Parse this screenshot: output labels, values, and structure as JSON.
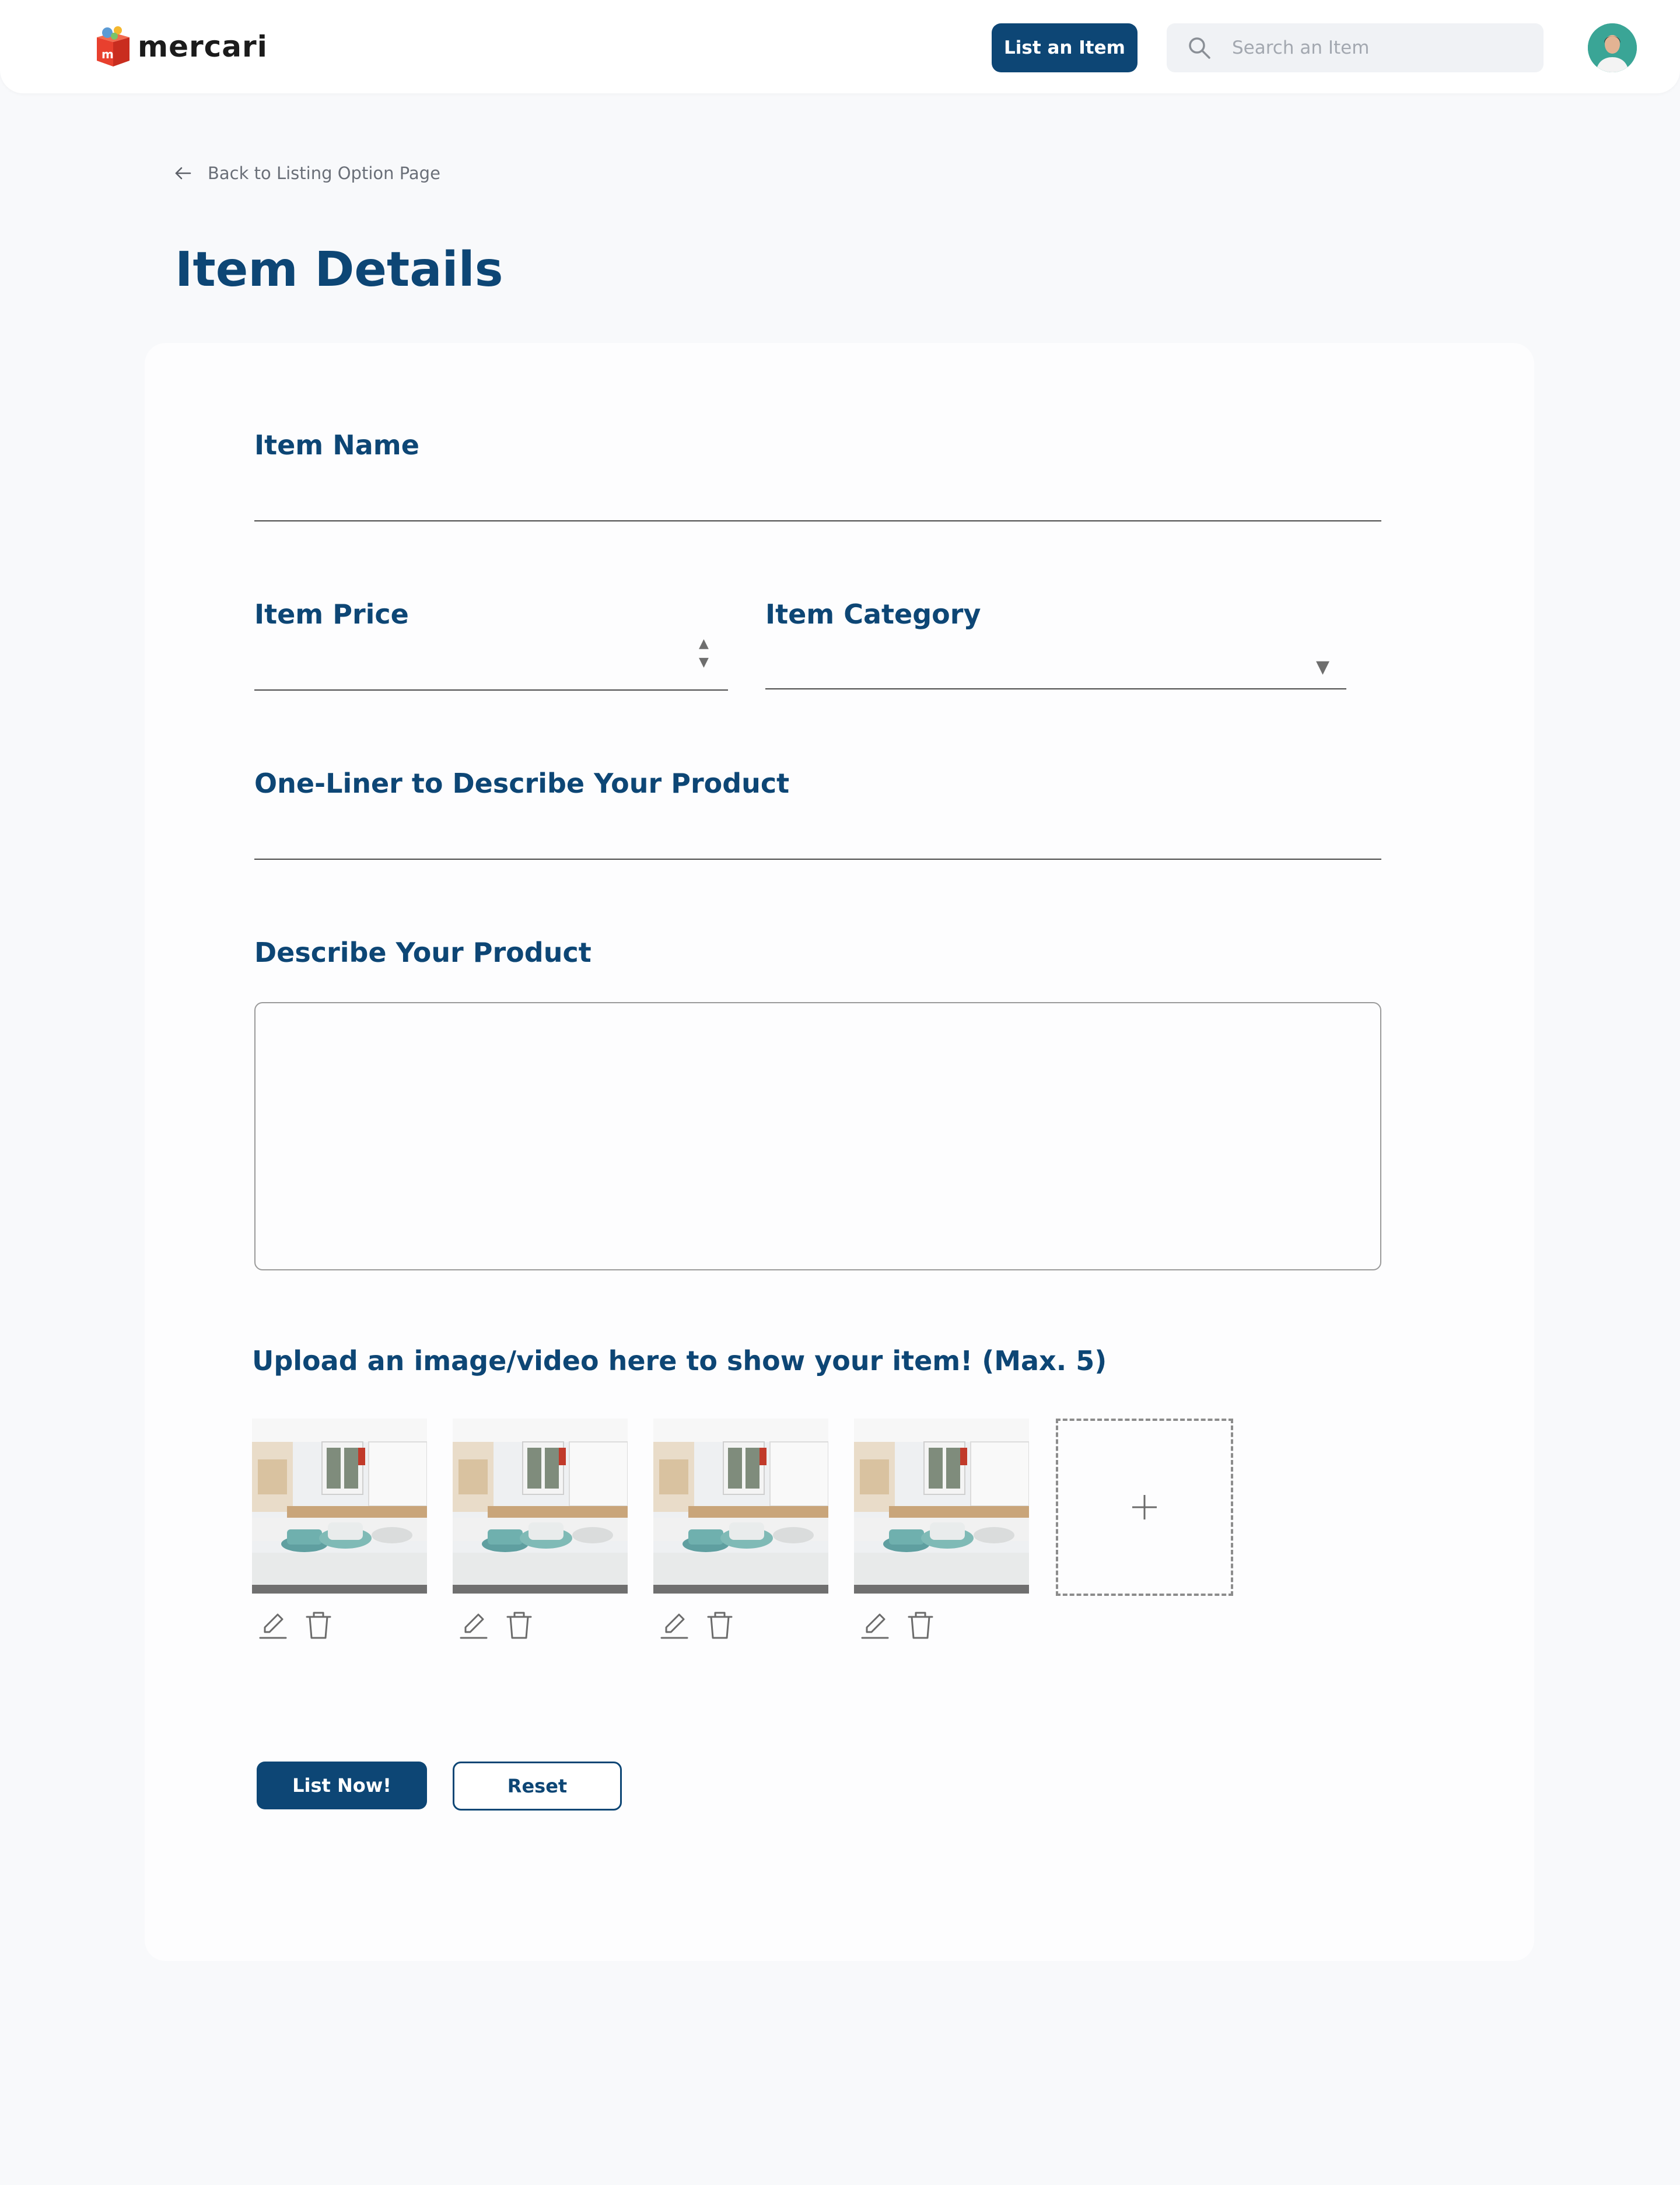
{
  "header": {
    "logo_text": "mercari",
    "list_button": "List an Item",
    "search_placeholder": "Search an Item"
  },
  "nav": {
    "back_label": "Back to Listing Option Page"
  },
  "page": {
    "title": "Item Details"
  },
  "form": {
    "item_name_label": "Item Name",
    "item_price_label": "Item Price",
    "item_category_label": "Item Category",
    "one_liner_label": "One-Liner to Describe Your Product",
    "description_label": "Describe Your Product",
    "upload_label": "Upload an image/video here to show your  item! (Max. 5)",
    "item_name_value": "",
    "item_price_value": "",
    "item_category_value": "",
    "one_liner_value": "",
    "description_value": ""
  },
  "uploads": {
    "count": 4,
    "max": 5,
    "thumbnail_subject": "kitchen with teal cookware on counter",
    "add_icon": "plus-icon",
    "actions": [
      "pencil-icon",
      "trash-icon"
    ]
  },
  "actions": {
    "submit": "List Now!",
    "reset": "Reset"
  },
  "colors": {
    "brand": "#0d4675",
    "background": "#f8f9fb",
    "card": "#fdfdfe",
    "avatar_bg": "#3aa596"
  }
}
